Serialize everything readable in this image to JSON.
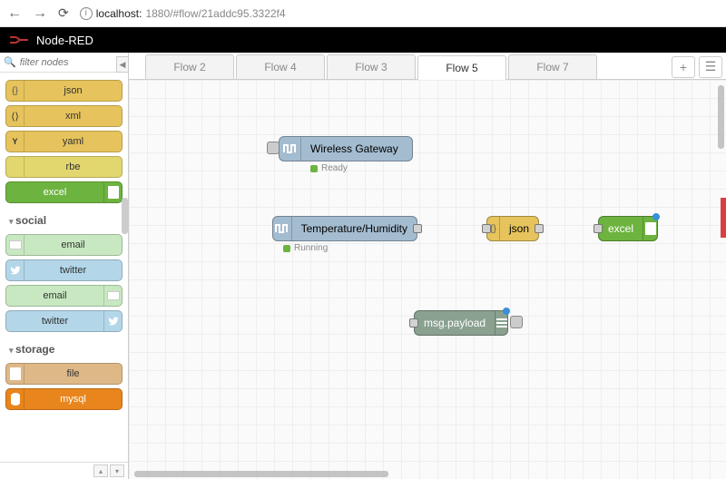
{
  "browser": {
    "host": "localhost:",
    "port_path": "1880/#flow/21addc95.3322f4"
  },
  "app_title": "Node-RED",
  "filter_placeholder": "filter nodes",
  "palette": {
    "json": "json",
    "xml": "xml",
    "yaml": "yaml",
    "rbe": "rbe",
    "excel": "excel",
    "email1": "email",
    "twitter1": "twitter",
    "email2": "email",
    "twitter2": "twitter",
    "file": "file",
    "mysql": "mysql",
    "cat_social": "social",
    "cat_storage": "storage"
  },
  "tabs": {
    "t1": "Flow 2",
    "t2": "Flow 4",
    "t3": "Flow 3",
    "t4": "Flow 5",
    "t5": "Flow 7"
  },
  "nodes": {
    "gateway": "Wireless Gateway",
    "gateway_status": "Ready",
    "temp": "Temperature/Humidity",
    "temp_status": "Running",
    "json": "json",
    "excel": "excel",
    "debug": "msg.payload"
  }
}
